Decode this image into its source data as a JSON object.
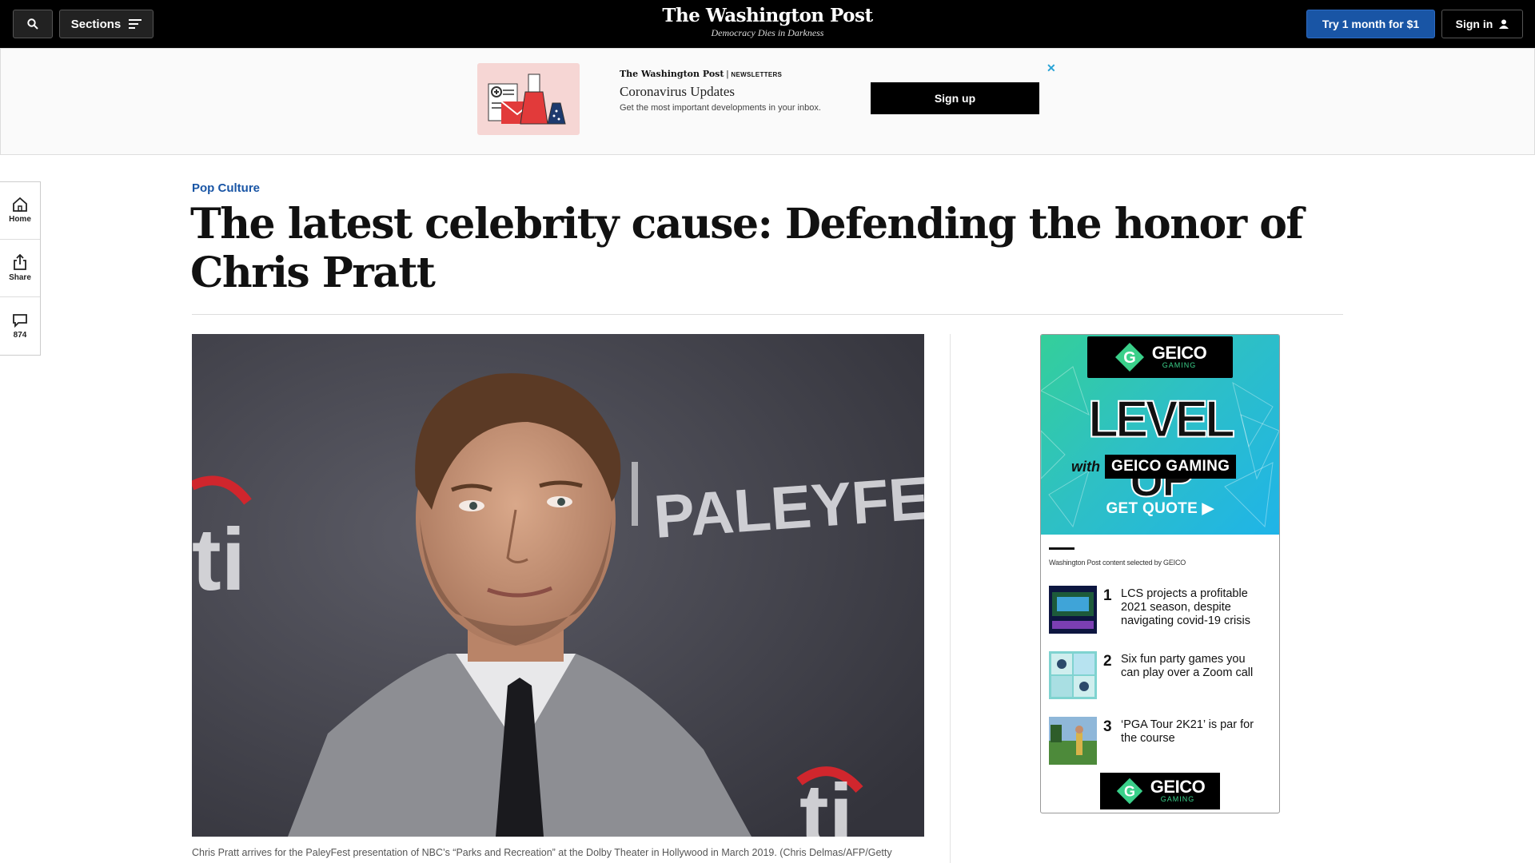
{
  "topbar": {
    "search_label": "",
    "sections_label": "Sections",
    "logo_name": "The Washington Post",
    "logo_tagline": "Democracy Dies in Darkness",
    "try_label": "Try 1 month for $1",
    "signin_label": "Sign in"
  },
  "newsletter_ad": {
    "brand": "The Washington Post",
    "brand_sub": "NEWSLETTERS",
    "title": "Coronavirus Updates",
    "description": "Get the most important developments in your inbox.",
    "signup_label": "Sign up",
    "close_label": "✕"
  },
  "rail": {
    "home_label": "Home",
    "share_label": "Share",
    "comments_count": "874"
  },
  "article": {
    "kicker": "Pop Culture",
    "headline": "The latest celebrity cause: Defending the honor of Chris Pratt",
    "photo_sign_text": "PALEYFEST",
    "caption": "Chris Pratt arrives for the PaleyFest presentation of NBC’s “Parks and Recreation” at the Dolby Theater in Hollywood in March 2019. (Chris Delmas/AFP/Getty"
  },
  "geico_ad": {
    "logo_word": "GEICO",
    "logo_sub": "GAMING",
    "headline": "LEVEL UP",
    "with_word": "with",
    "banner": "GEICO GAMING",
    "cta": "GET QUOTE ▶",
    "selected_by": "Washington Post content selected by GEICO",
    "items": [
      {
        "num": "1",
        "text": "LCS projects a profitable 2021 season, despite navigating covid-19 crisis"
      },
      {
        "num": "2",
        "text": "Six fun party games you can play over a Zoom call"
      },
      {
        "num": "3",
        "text": "‘PGA Tour 2K21’ is par for the course"
      }
    ]
  },
  "colors": {
    "accent_blue": "#1955a5",
    "topbar_bg": "#000000",
    "geico_green": "#34cf9a"
  }
}
